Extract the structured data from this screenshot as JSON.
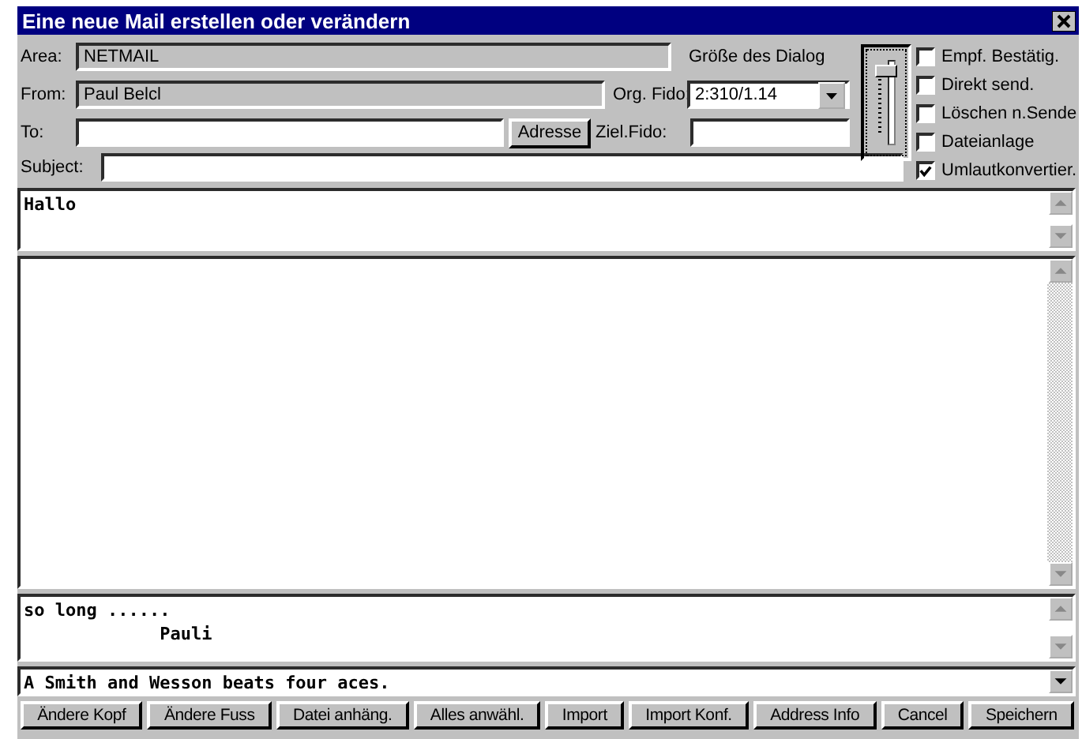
{
  "window": {
    "title": "Eine neue Mail erstellen oder verändern"
  },
  "area": {
    "label": "Area:",
    "value": "NETMAIL"
  },
  "dialog_size": {
    "label": "Größe des Dialog",
    "level": 0.95
  },
  "from": {
    "label": "From:",
    "value": "Paul Belcl"
  },
  "org_fido": {
    "label": "Org. Fido:",
    "value": "2:310/1.14"
  },
  "to": {
    "label": "To:"
  },
  "address_button": "Adresse",
  "ziel_fido": {
    "label": "Ziel.Fido:"
  },
  "subject": {
    "label": "Subject:"
  },
  "options": [
    {
      "label": "Empf. Bestätig.",
      "checked": false
    },
    {
      "label": "Direkt send.",
      "checked": false
    },
    {
      "label": "Löschen n.Sende",
      "checked": false
    },
    {
      "label": "Dateianlage",
      "checked": false
    },
    {
      "label": "Umlautkonvertier.",
      "checked": true
    }
  ],
  "header_text": "Hallo",
  "signature": [
    "so long ......",
    "             Pauli"
  ],
  "tagline": "A Smith and Wesson beats four aces.",
  "buttons": [
    "Ändere Kopf",
    "Ändere Fuss",
    "Datei anhäng.",
    "Alles anwähl.",
    "Import",
    "Import Konf.",
    "Address Info",
    "Cancel",
    "Speichern"
  ]
}
